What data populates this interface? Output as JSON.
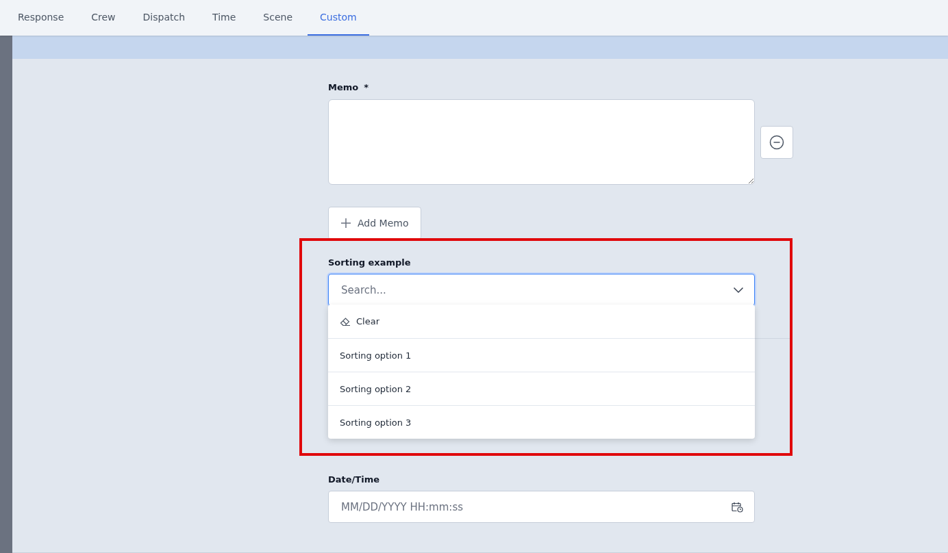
{
  "tabs": [
    {
      "label": "Response",
      "selected": false
    },
    {
      "label": "Crew",
      "selected": false
    },
    {
      "label": "Dispatch",
      "selected": false
    },
    {
      "label": "Time",
      "selected": false
    },
    {
      "label": "Scene",
      "selected": false
    },
    {
      "label": "Custom",
      "selected": true
    }
  ],
  "memo": {
    "label": "Memo",
    "required_mark": "*",
    "add_button": "Add Memo"
  },
  "sorting": {
    "label": "Sorting example",
    "placeholder": "Search...",
    "expanded": true,
    "highlighted": true,
    "options": [
      {
        "kind": "clear",
        "label": "Clear"
      },
      {
        "kind": "option",
        "label": "Sorting option 1"
      },
      {
        "kind": "option",
        "label": "Sorting option 2"
      },
      {
        "kind": "option",
        "label": "Sorting option 3"
      }
    ]
  },
  "datetime": {
    "label": "Date/Time",
    "placeholder": "MM/DD/YYYY HH:mm:ss"
  }
}
